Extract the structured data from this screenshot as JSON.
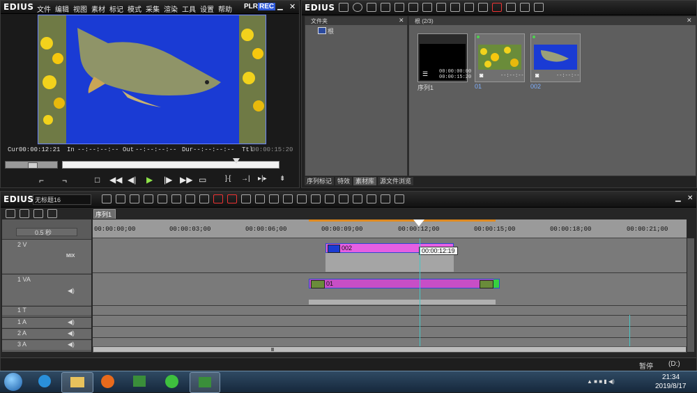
{
  "colors": {
    "accent_pink": "#e65fe3",
    "clip_pink": "#c74ec6",
    "timeline_bg": "#7a7a7a",
    "playhead": "#47c7c7"
  },
  "player": {
    "logo": "EDIUS",
    "menu": [
      "文件",
      "编辑",
      "视图",
      "素材",
      "标记",
      "模式",
      "采集",
      "渲染",
      "工具",
      "设置",
      "帮助"
    ],
    "plr": "PLR",
    "rec": "REC",
    "timecodes": {
      "cur_label": "Cur",
      "cur": "00:00:12:21",
      "in_label": "In",
      "in": "--:--:--:--",
      "out_label": "Out",
      "out": "--:--:--:--",
      "dur_label": "Dur",
      "dur": "--:--:--:--",
      "ttl_label": "Ttl",
      "ttl": "00:00:15:20"
    }
  },
  "bin": {
    "logo": "EDIUS",
    "folder_title": "文件夹",
    "root_label": "根",
    "bin_header": "根 (2/3)",
    "clips": [
      {
        "name": "序列1",
        "tc1": "00:00:00:00",
        "tc2": "00:00:15:20"
      },
      {
        "name": "01",
        "tc": "--:--:--"
      },
      {
        "name": "002",
        "tc": "--:--:--"
      }
    ],
    "tabs": [
      "序列标记",
      "特效",
      "素材库",
      "源文件浏览"
    ]
  },
  "timeline": {
    "logo": "EDIUS",
    "project_name": "无标题16",
    "sequence_tab": "序列1",
    "zoom": "0.5 秒",
    "ruler": [
      "00:00:00;00",
      "00:00:03;00",
      "00:00:06;00",
      "00:00:09;00",
      "00:00:12;00",
      "00:00:15;00",
      "00:00:18;00",
      "00:00:21;00"
    ],
    "tooltip": "00:00:12:19",
    "tracks": [
      {
        "name": "2 V",
        "mix": "MIX"
      },
      {
        "name": "1 VA"
      },
      {
        "name": "1 T"
      },
      {
        "name": "1 A"
      },
      {
        "name": "2 A"
      },
      {
        "name": "3 A"
      }
    ],
    "clips": {
      "v2": "002",
      "v1": "01"
    },
    "status_pause": "暂停",
    "status_d": "(D:)"
  },
  "taskbar": {
    "time": "21:34",
    "date": "2019/8/17"
  }
}
